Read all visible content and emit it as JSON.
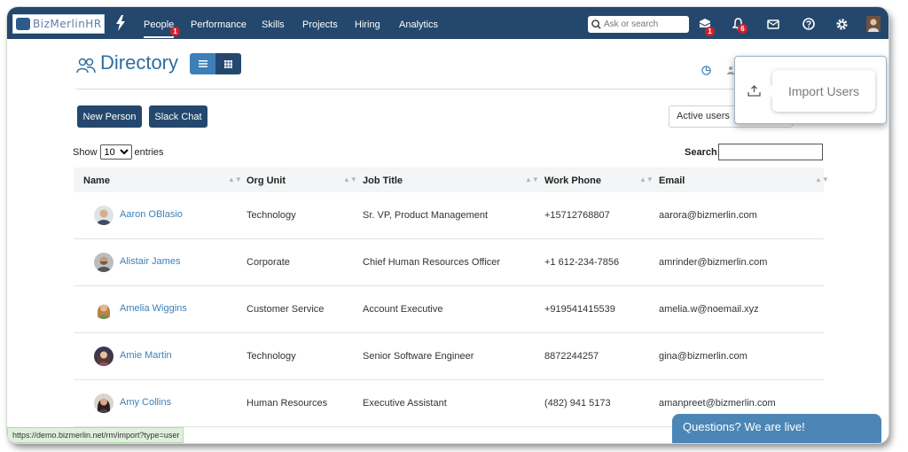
{
  "nav": {
    "brand": "BizMerlinHR",
    "items": [
      {
        "label": "People",
        "badge": "1"
      },
      {
        "label": "Performance"
      },
      {
        "label": "Skills"
      },
      {
        "label": "Projects"
      },
      {
        "label": "Hiring"
      },
      {
        "label": "Analytics"
      }
    ],
    "search_placeholder": "Ask or search",
    "badges": {
      "inbox": "1",
      "notifications": "6"
    }
  },
  "header": {
    "title": "Directory",
    "buttons": {
      "new_person": "New Person",
      "slack_chat": "Slack Chat"
    },
    "filter_value": "Active users"
  },
  "popup": {
    "item_label": "Import Users"
  },
  "table_controls": {
    "show_label": "Show",
    "entries_value": "10",
    "entries_label": "entries",
    "search_label": "Search:"
  },
  "table": {
    "columns": [
      "Name",
      "Org Unit",
      "Job Title",
      "Work Phone",
      "Email"
    ],
    "rows": [
      {
        "name": "Aaron OBlasio",
        "org_unit": "Technology",
        "job_title": "Sr. VP, Product Management",
        "phone": "+15712768807",
        "email": "aarora@bizmerlin.com"
      },
      {
        "name": "Alistair James",
        "org_unit": "Corporate",
        "job_title": "Chief Human Resources Officer",
        "phone": "+1 612-234-7856",
        "email": "amrinder@bizmerlin.com"
      },
      {
        "name": "Amelia Wiggins",
        "org_unit": "Customer Service",
        "job_title": "Account Executive",
        "phone": "+919541415539",
        "email": "amelia.w@noemail.xyz"
      },
      {
        "name": "Amie Martin",
        "org_unit": "Technology",
        "job_title": "Senior Software Engineer",
        "phone": "8872244257",
        "email": "gina@bizmerlin.com"
      },
      {
        "name": "Amy Collins",
        "org_unit": "Human Resources",
        "job_title": "Executive Assistant",
        "phone": "(482) 941 5173",
        "email": "amanpreet@bizmerlin.com"
      }
    ]
  },
  "status_url": "https://demo.bizmerlin.net/rm/import?type=user",
  "chat_label": "Questions? We are live!",
  "colors": {
    "nav_bg": "#24486d",
    "accent": "#3d7fb8",
    "badge": "#d0202a",
    "chat": "#4b86b6"
  }
}
